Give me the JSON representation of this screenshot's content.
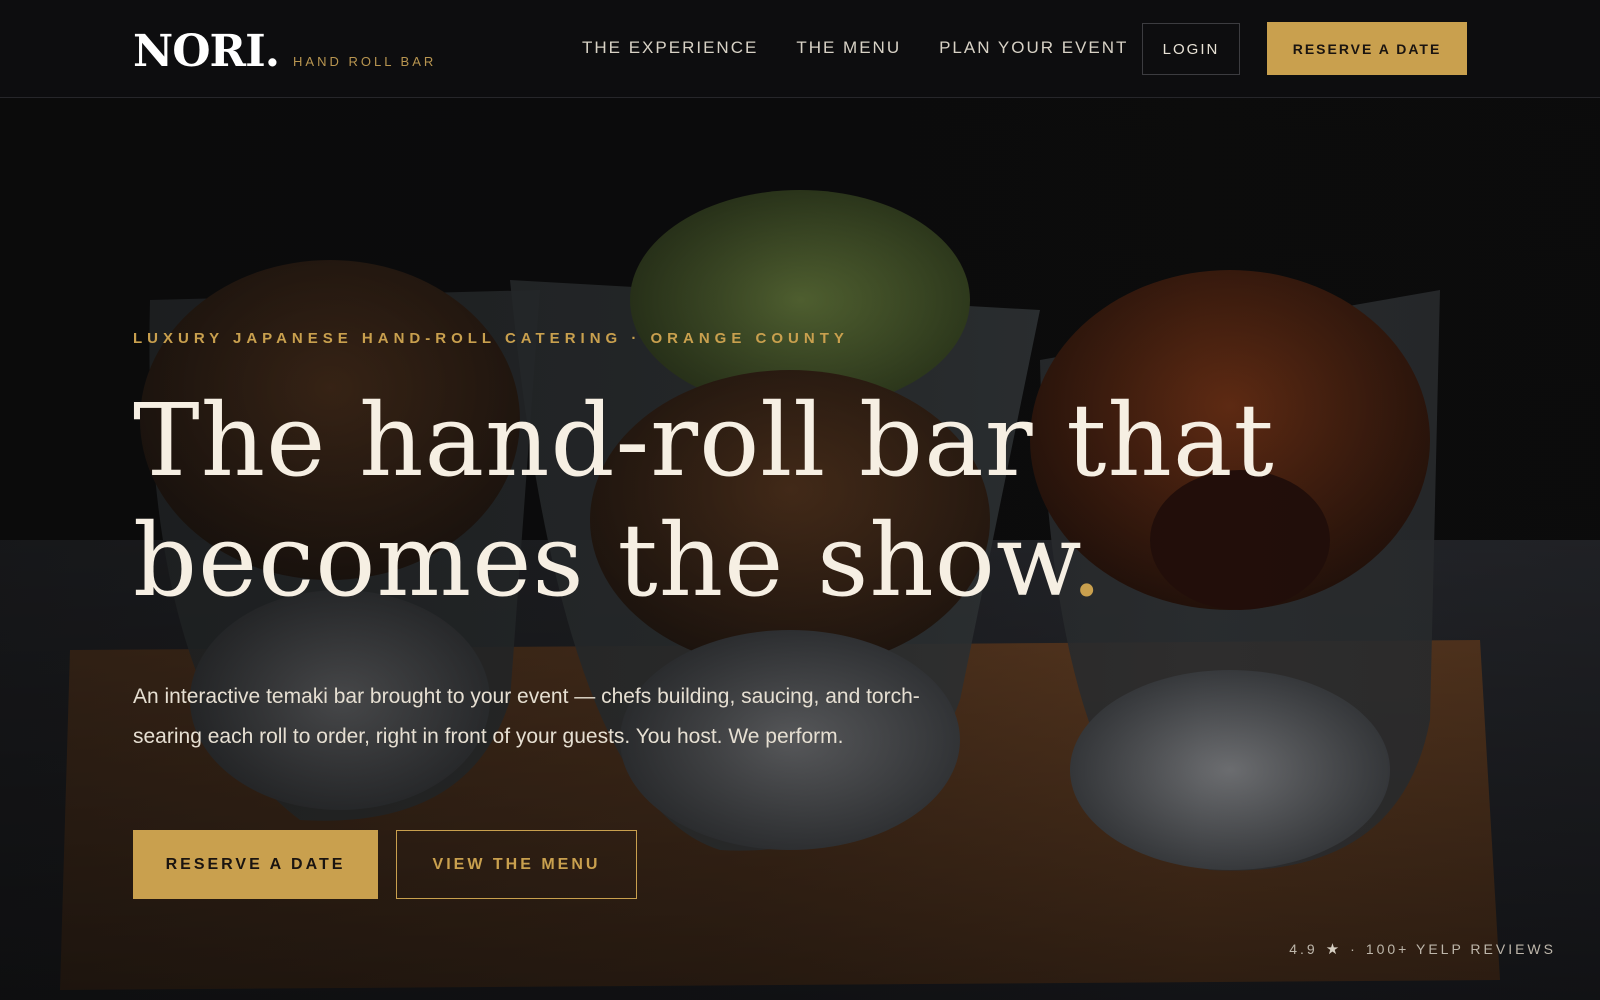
{
  "colors": {
    "accent": "#c9a04e",
    "background": "#0b0b0b",
    "header": "#0e0e10",
    "text": "#f6efe3"
  },
  "header": {
    "logo": "NORI.",
    "tagline": "HAND ROLL BAR",
    "nav": [
      {
        "label": "THE EXPERIENCE"
      },
      {
        "label": "THE MENU"
      },
      {
        "label": "PLAN YOUR EVENT"
      }
    ],
    "login_label": "LOGIN",
    "reserve_label": "RESERVE A DATE"
  },
  "hero": {
    "eyebrow": "LUXURY JAPANESE HAND-ROLL CATERING · ORANGE COUNTY",
    "headline_line1": "The hand-roll bar that",
    "headline_line2": "becomes the show",
    "headline_dot": ".",
    "description": "An interactive temaki bar brought to your event — chefs building, saucing, and torch-searing each roll to order, right in front of your guests. You host. We perform.",
    "primary_cta": "RESERVE A DATE",
    "secondary_cta": "VIEW THE MENU",
    "background_image": "temaki-hand-rolls-photo"
  },
  "rating": {
    "score": "4.9",
    "star_icon": "star-icon",
    "separator": "·",
    "reviews": "100+ YELP REVIEWS"
  }
}
